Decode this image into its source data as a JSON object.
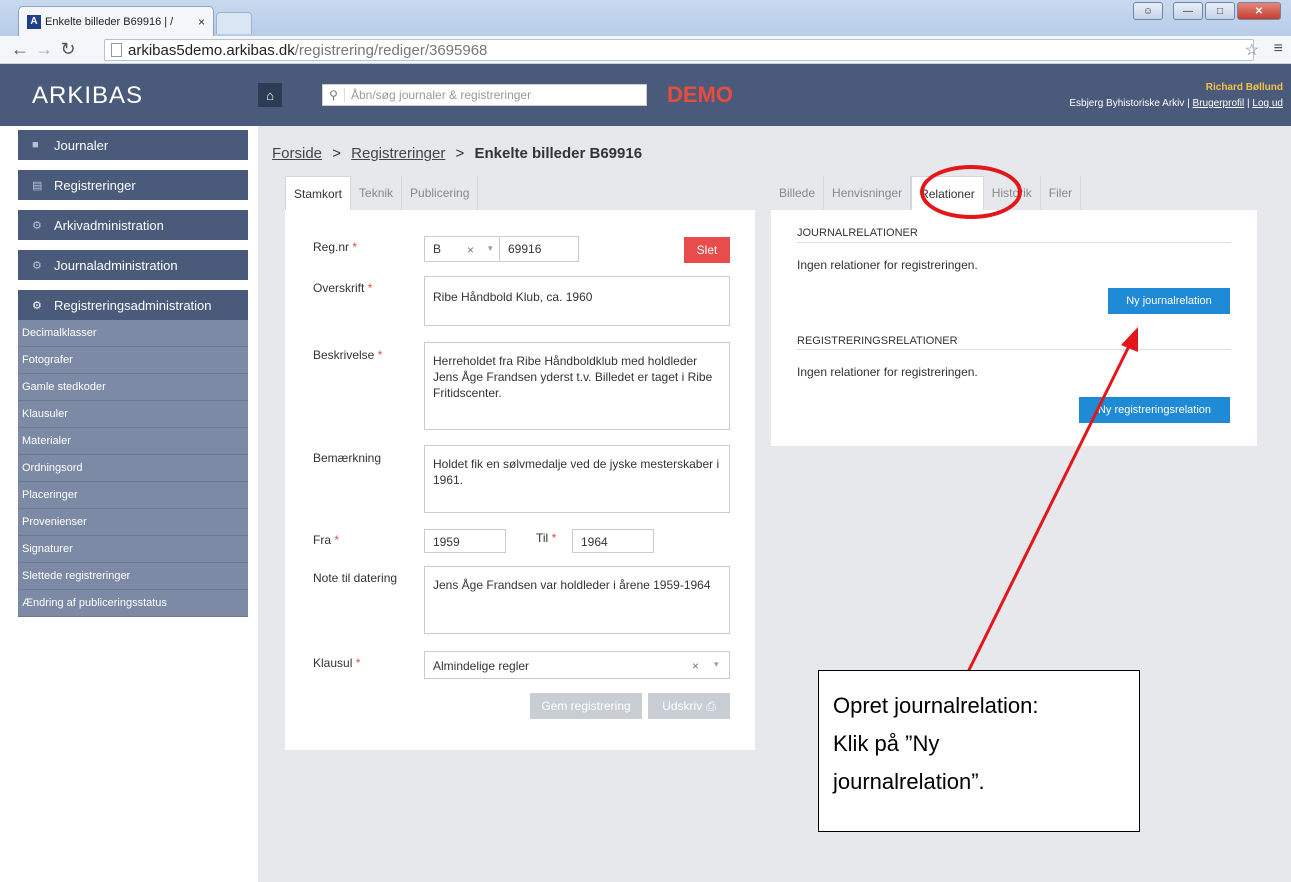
{
  "browser": {
    "tab_title": "Enkelte billeder B69916 | /",
    "tab_close": "×",
    "url_host": "arkibas5demo.arkibas.dk",
    "url_path": "/registrering/rediger/3695968"
  },
  "header": {
    "logo": "ARKIBAS",
    "search_placeholder": "Åbn/søg journaler & registreringer",
    "demo_label": "DEMO",
    "user_name": "Richard Bøllund",
    "archive_name": "Esbjerg Byhistoriske Arkiv",
    "profile_link": "Brugerprofil",
    "logout_link": "Log ud"
  },
  "sidebar": {
    "main_items": [
      {
        "label": "Journaler",
        "icon": "folder-icon"
      },
      {
        "label": "Registreringer",
        "icon": "list-icon"
      },
      {
        "label": "Arkivadministration",
        "icon": "gear-icon"
      },
      {
        "label": "Journaladministration",
        "icon": "gear-icon"
      },
      {
        "label": "Registreringsadministration",
        "icon": "gear-icon"
      }
    ],
    "sub_items": [
      "Decimalklasser",
      "Fotografer",
      "Gamle stedkoder",
      "Klausuler",
      "Materialer",
      "Ordningsord",
      "Placeringer",
      "Provenienser",
      "Signaturer",
      "Slettede registreringer",
      "Ændring af publiceringsstatus"
    ]
  },
  "breadcrumb": {
    "home": "Forside",
    "section": "Registreringer",
    "sep": ">",
    "current": "Enkelte billeder B69916"
  },
  "left_tabs": [
    "Stamkort",
    "Teknik",
    "Publicering"
  ],
  "right_tabs": [
    "Billede",
    "Henvisninger",
    "Relationer",
    "Historik",
    "Filer"
  ],
  "form": {
    "regnr_label": "Reg.nr",
    "regnr_prefix": "B",
    "regnr_value": "69916",
    "delete_button": "Slet",
    "overskrift_label": "Overskrift",
    "overskrift_value": "Ribe Håndbold Klub, ca. 1960",
    "beskrivelse_label": "Beskrivelse",
    "beskrivelse_value": "Herreholdet fra Ribe Håndboldklub med holdleder Jens Åge Frandsen yderst t.v. Billedet er taget i Ribe Fritidscenter.",
    "bemaerkning_label": "Bemærkning",
    "bemaerkning_value": "Holdet fik en sølvmedalje ved de jyske mesterskaber i 1961.",
    "fra_label": "Fra",
    "fra_value": "1959",
    "til_label": "Til",
    "til_value": "1964",
    "note_label": "Note til datering",
    "note_value": "Jens Åge Frandsen var holdleder i årene 1959-1964",
    "klausul_label": "Klausul",
    "klausul_value": "Almindelige regler",
    "required_mark": "*",
    "clear_mark": "×",
    "dropdown_mark": "▾",
    "save_button": "Gem registrering",
    "print_button": "Udskriv"
  },
  "relations": {
    "journal_title": "JOURNALRELATIONER",
    "journal_empty": "Ingen relationer for registreringen.",
    "journal_button": "Ny journalrelation",
    "reg_title": "REGISTRERINGSRELATIONER",
    "reg_empty": "Ingen relationer for registreringen.",
    "reg_button": "Ny registreringsrelation"
  },
  "annotation": {
    "line1": "Opret journalrelation:",
    "line2": "Klik på ”Ny",
    "line3": "journalrelation”.",
    "color": "#e3161a"
  },
  "colors": {
    "header_bg": "#4a5a7a",
    "accent_blue": "#1f8ad6",
    "danger_red": "#e84c4c",
    "demo_red": "#e74c3c",
    "user_gold": "#f5c04a"
  }
}
